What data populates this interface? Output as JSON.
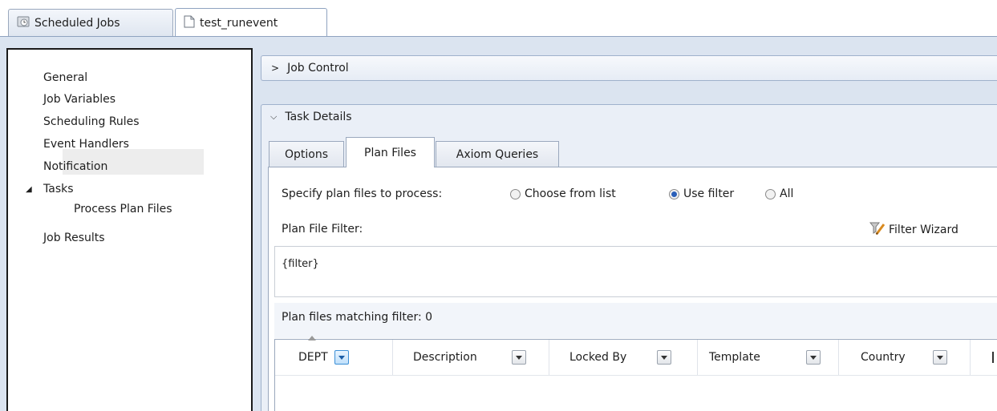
{
  "tabs": [
    {
      "label": "Scheduled Jobs",
      "icon": "scheduled-jobs-icon"
    },
    {
      "label": "test_runevent",
      "icon": "document-icon"
    }
  ],
  "nav": {
    "items": [
      "General",
      "Job Variables",
      "Scheduling Rules",
      "Event Handlers",
      "Notification",
      "Tasks",
      "Process Plan Files",
      "Job Results"
    ],
    "selected": "Process Plan Files"
  },
  "sections": {
    "job_control": "Job Control",
    "task_details": "Task Details"
  },
  "inner_tabs": [
    "Options",
    "Plan Files",
    "Axiom Queries"
  ],
  "plan_files": {
    "specify_label": "Specify plan files to process:",
    "options": [
      "Choose from list",
      "Use filter",
      "All"
    ],
    "selected_option": "Use filter",
    "filter_label": "Plan File Filter:",
    "filter_wizard": "Filter Wizard",
    "filter_value": "{filter}",
    "matching_label": "Plan files matching filter: 0"
  },
  "grid": {
    "columns": [
      "DEPT",
      "Description",
      "Locked By",
      "Template",
      "Country"
    ]
  },
  "colors": {
    "frame": "#dbe4f0",
    "accent": "#3c8fd6",
    "radio_selected": "#2a5fb8"
  }
}
